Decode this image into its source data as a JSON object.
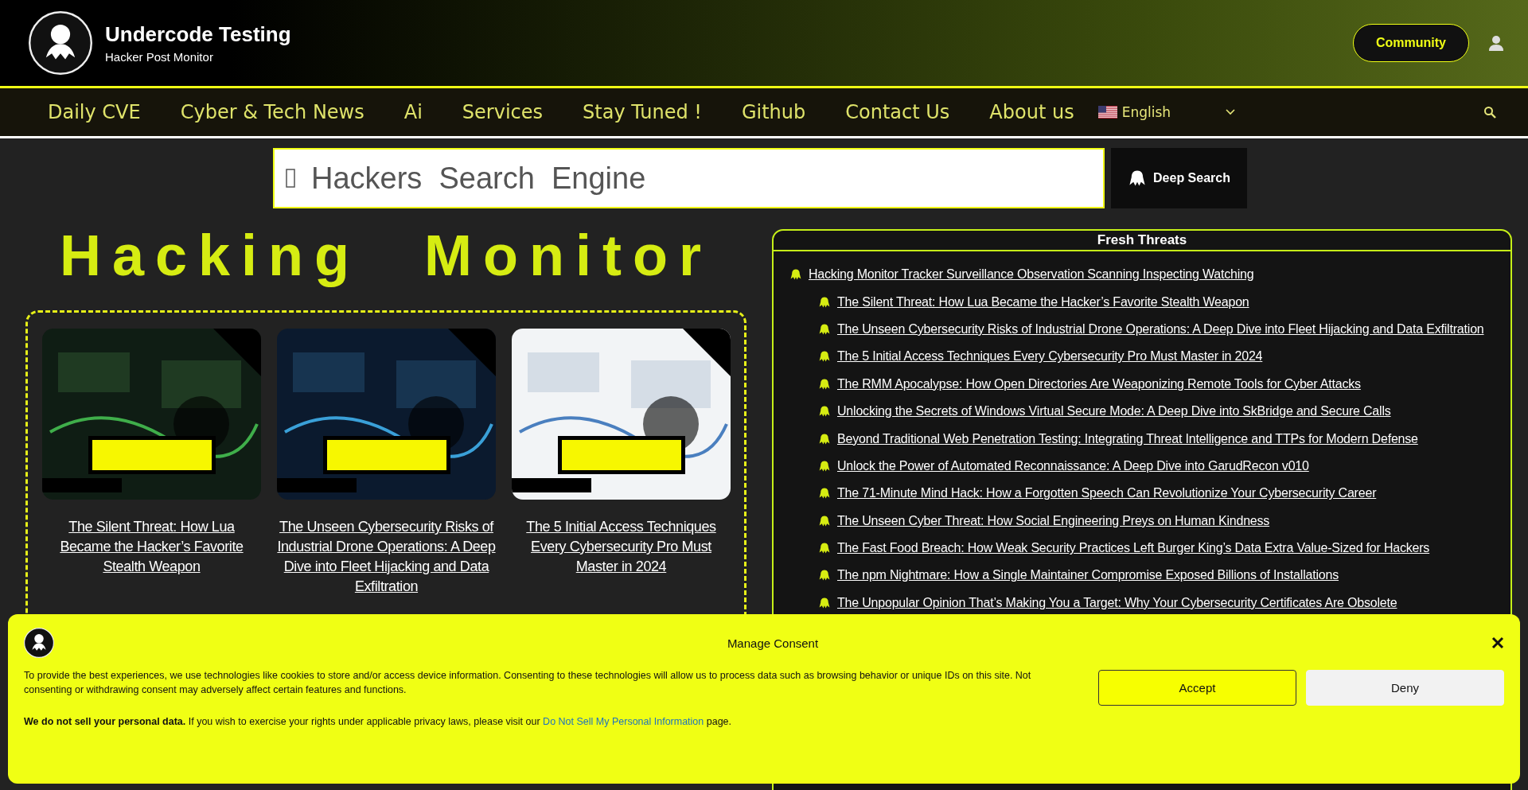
{
  "header": {
    "site_title": "Undercode Testing",
    "tagline": "Hacker Post Monitor",
    "community_button": "Community"
  },
  "nav": {
    "items": [
      "Daily CVE",
      "Cyber & Tech News",
      "Ai",
      "Services",
      "Stay Tuned !",
      "Github",
      "Contact Us",
      "About us"
    ],
    "language": "English"
  },
  "search": {
    "placeholder": "Hackers  Search  Engine",
    "button": "Deep Search"
  },
  "headline": {
    "word_1": "Hacking",
    "word_2": "Monitor"
  },
  "cards": [
    {
      "title": "The Silent Threat: How Lua Became the Hacker’s Favorite Stealth Weapon"
    },
    {
      "title": "The Unseen Cybersecurity Risks of Industrial Drone Operations: A Deep Dive into Fleet Hijacking and Data Exfiltration"
    },
    {
      "title": "The 5 Initial Access Techniques Every Cybersecurity Pro Must Master in 2024"
    }
  ],
  "fresh_threats": {
    "title": "Fresh Threats",
    "items": [
      {
        "label": "Hacking Monitor Tracker Surveillance Observation Scanning Inspecting Watching",
        "children": [
          {
            "label": "The Silent Threat: How Lua Became the Hacker’s Favorite Stealth Weapon"
          },
          {
            "label": "The Unseen Cybersecurity Risks of Industrial Drone Operations: A Deep Dive into Fleet Hijacking and Data Exfiltration"
          },
          {
            "label": "The 5 Initial Access Techniques Every Cybersecurity Pro Must Master in 2024"
          },
          {
            "label": "The RMM Apocalypse: How Open Directories Are Weaponizing Remote Tools for Cyber Attacks"
          },
          {
            "label": "Unlocking the Secrets of Windows Virtual Secure Mode: A Deep Dive into SkBridge and Secure Calls"
          },
          {
            "label": "Beyond Traditional Web Penetration Testing: Integrating Threat Intelligence and TTPs for Modern Defense"
          },
          {
            "label": "Unlock the Power of Automated Reconnaissance: A Deep Dive into GarudRecon v010"
          },
          {
            "label": "The 71-Minute Mind Hack: How a Forgotten Speech Can Revolutionize Your Cybersecurity Career"
          },
          {
            "label": "The Unseen Cyber Threat: How Social Engineering Preys on Human Kindness"
          },
          {
            "label": "The Fast Food Breach: How Weak Security Practices Left Burger King’s Data Extra Value-Sized for Hackers"
          },
          {
            "label": "The npm Nightmare: How a Single Maintainer Compromise Exposed Billions of Installations"
          },
          {
            "label": "The Unpopular Opinion That’s Making You a Target: Why Your Cybersecurity Certificates Are Obsolete"
          }
        ]
      }
    ]
  },
  "consent": {
    "title": "Manage Consent",
    "text": "To provide the best experiences, we use technologies like cookies to store and/or access device information. Consenting to these technologies will allow us to process data such as browsing behavior or unique IDs on this site. Not consenting or withdrawing consent may adversely affect certain features and functions.",
    "notice_before": "**We do not sell your personal data.** If you wish to exercise your rights under applicable privacy laws, please visit our",
    "notice_link": "Do Not Sell My Personal Information",
    "notice_after": "page.",
    "accept_button": "Accept",
    "deny_button": "Deny"
  }
}
